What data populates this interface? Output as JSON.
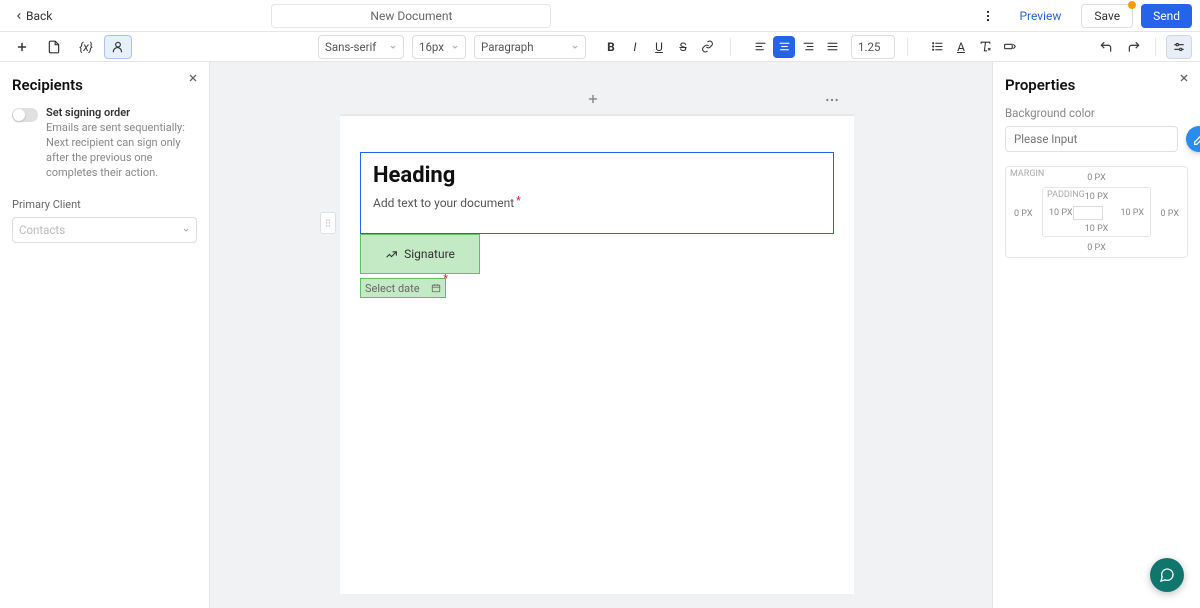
{
  "topbar": {
    "back_label": "Back",
    "title": "New Document",
    "preview_label": "Preview",
    "save_label": "Save",
    "send_label": "Send"
  },
  "toolbar": {
    "font_family": "Sans-serif",
    "font_size": "16px",
    "block_type": "Paragraph",
    "line_height": "1.25"
  },
  "left_panel": {
    "title": "Recipients",
    "toggle_label": "Set signing order",
    "toggle_desc": "Emails are sent sequentially: Next recipient can sign only after the previous one completes their action.",
    "primary_label": "Primary Client",
    "contacts_placeholder": "Contacts"
  },
  "editor": {
    "heading": "Heading",
    "placeholder_text": "Add text to your document",
    "signature_label": "Signature",
    "date_placeholder": "Select date"
  },
  "right_panel": {
    "title": "Properties",
    "bg_label": "Background color",
    "bg_placeholder": "Please Input",
    "spacing": {
      "margin_label": "MARGIN",
      "padding_label": "PADDING",
      "margin_top": "0 PX",
      "margin_right": "0 PX",
      "margin_bottom": "0 PX",
      "margin_left": "0 PX",
      "padding_top": "10 PX",
      "padding_right": "10 PX",
      "padding_bottom": "10 PX",
      "padding_left": "10 PX"
    }
  }
}
